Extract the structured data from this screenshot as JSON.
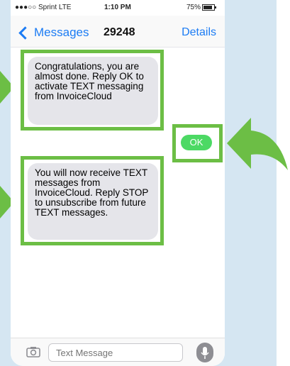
{
  "status_bar": {
    "carrier": "●●●○○ Sprint  LTE",
    "time": "1:10 PM",
    "battery": "75%"
  },
  "nav": {
    "back_label": "Messages",
    "title": "29248",
    "details_label": "Details"
  },
  "messages": [
    {
      "direction": "incoming",
      "text": "Congratulations, you are almost done. Reply OK to activate TEXT messaging from InvoiceCloud"
    },
    {
      "direction": "outgoing",
      "text": "OK"
    },
    {
      "direction": "incoming",
      "text": "You will now receive TEXT messages from InvoiceCloud. Reply STOP to unsubscribe from future TEXT messages."
    }
  ],
  "input": {
    "placeholder": "Text Message"
  },
  "colors": {
    "highlight": "#6cbe45",
    "ios_blue": "#1c7cf4",
    "outgoing_bubble": "#4cd964",
    "incoming_bubble": "#e5e5ea",
    "background_panel": "#d5e6f2"
  },
  "icons": [
    "back-chevron-icon",
    "battery-icon",
    "camera-icon",
    "microphone-icon",
    "pointer-arrow-icon"
  ]
}
